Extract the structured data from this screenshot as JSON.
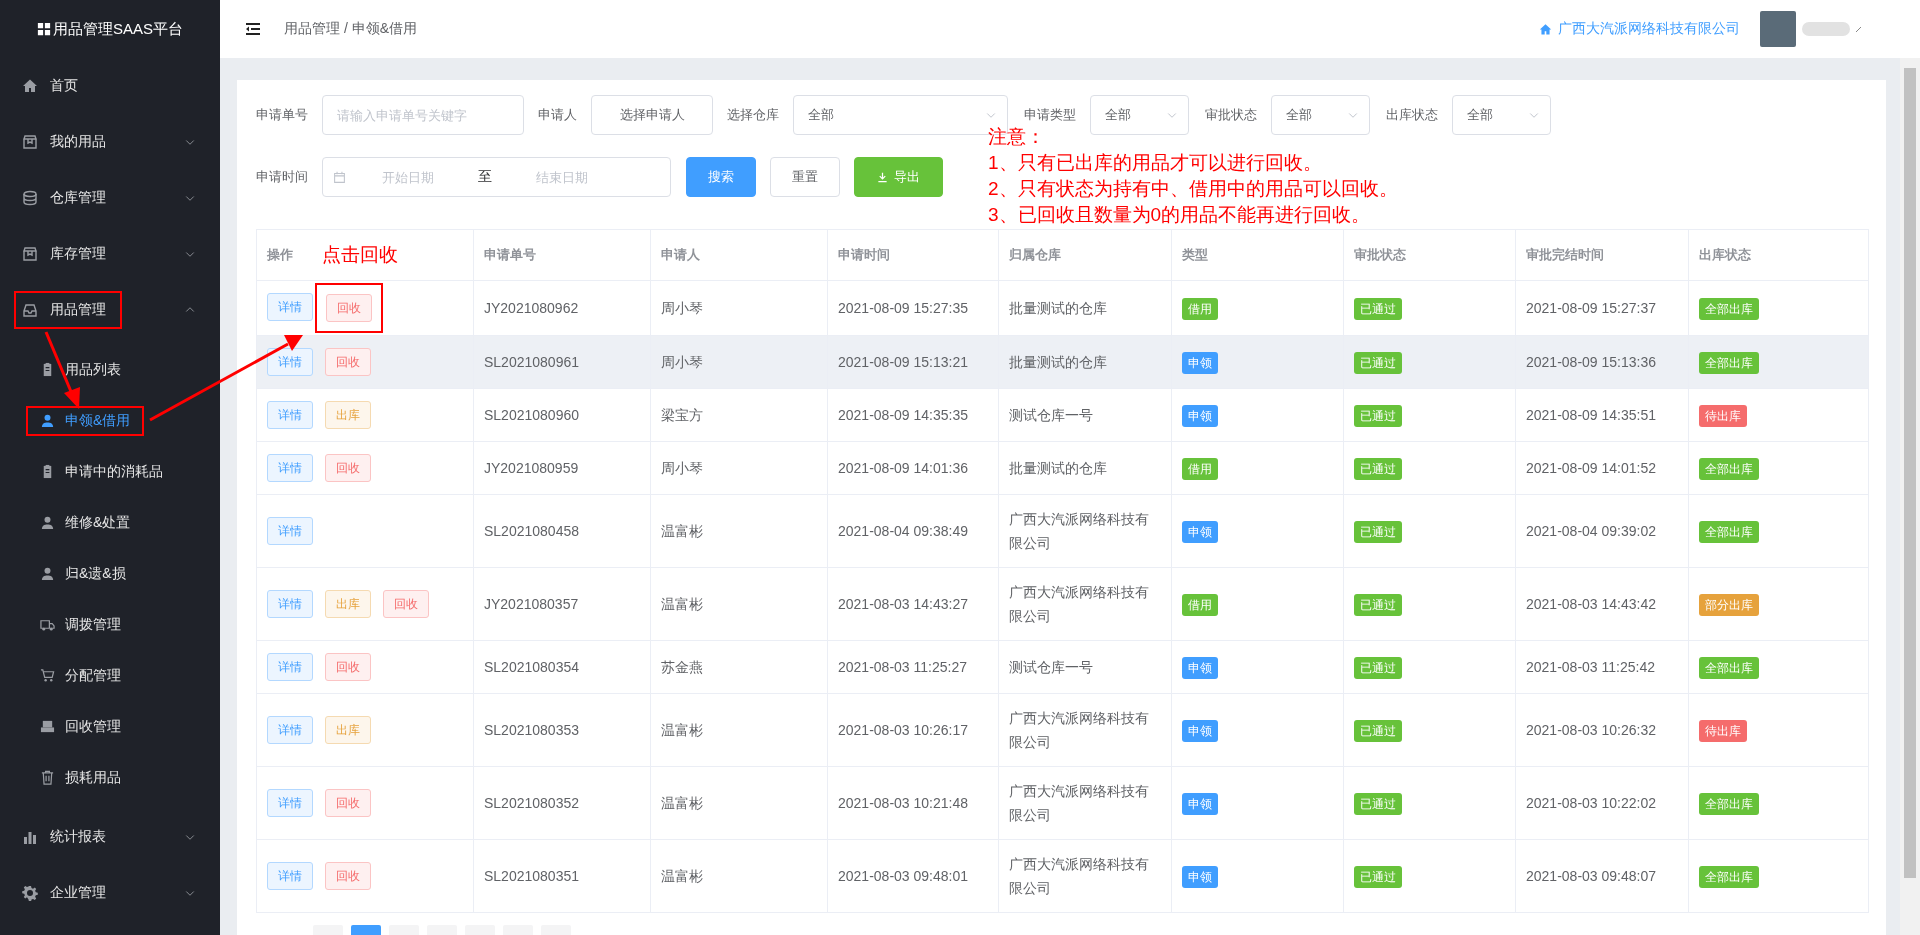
{
  "sidebar": {
    "logo": "用品管理SAAS平台",
    "items": [
      {
        "label": "首页"
      },
      {
        "label": "我的用品",
        "expanded": false
      },
      {
        "label": "仓库管理",
        "expanded": false
      },
      {
        "label": "库存管理",
        "expanded": false
      },
      {
        "label": "用品管理",
        "expanded": true,
        "children": [
          {
            "label": "用品列表",
            "selected": false
          },
          {
            "label": "申领&借用",
            "selected": true
          },
          {
            "label": "申请中的消耗品",
            "selected": false
          },
          {
            "label": "维修&处置",
            "selected": false
          },
          {
            "label": "归&遗&损",
            "selected": false
          },
          {
            "label": "调拨管理",
            "selected": false
          },
          {
            "label": "分配管理",
            "selected": false
          },
          {
            "label": "回收管理",
            "selected": false
          },
          {
            "label": "损耗用品",
            "selected": false
          }
        ]
      },
      {
        "label": "统计报表",
        "expanded": false
      },
      {
        "label": "企业管理",
        "expanded": false
      }
    ]
  },
  "header": {
    "breadcrumb": "用品管理 / 申领&借用",
    "company": "广西大汽派网络科技有限公司"
  },
  "filters": {
    "row_1": [
      {
        "kind": "input",
        "label": "申请单号",
        "placeholder": "请输入申请单号关键字"
      },
      {
        "kind": "picker",
        "label": "申请人",
        "value": "选择申请人"
      },
      {
        "kind": "select",
        "label": "选择仓库",
        "value": "全部"
      },
      {
        "kind": "select",
        "label": "申请类型",
        "value": "全部"
      },
      {
        "kind": "select",
        "label": "审批状态",
        "value": "全部"
      },
      {
        "kind": "select",
        "label": "出库状态",
        "value": "全部"
      }
    ],
    "date_range": {
      "label": "申请时间",
      "start_placeholder": "开始日期",
      "separator": "至",
      "end_placeholder": "结束日期"
    },
    "buttons": [
      {
        "kind": "primary",
        "label": "搜索"
      },
      {
        "kind": "default",
        "label": "重置"
      },
      {
        "kind": "export",
        "label": "导出"
      }
    ]
  },
  "table": {
    "columns": [
      "操作",
      "申请单号",
      "申请人",
      "申请时间",
      "归属仓库",
      "类型",
      "审批状态",
      "审批完结时间",
      "出库状态"
    ],
    "rows": [
      {
        "hovered": false,
        "actions": [
          {
            "kind": "detail",
            "label": "详情"
          },
          {
            "kind": "recycle",
            "label": "回收"
          }
        ],
        "number": "JY2021080962",
        "applicant": "周小琴",
        "time": "2021-08-09 15:27:35",
        "warehouse": "批量测试的仓库",
        "type": {
          "text": "借用",
          "color": "#67c23a"
        },
        "approval": {
          "text": "已通过",
          "color": "#67c23a"
        },
        "finished": "2021-08-09 15:27:37",
        "outbound": {
          "text": "全部出库",
          "color": "#67c23a"
        }
      },
      {
        "hovered": true,
        "actions": [
          {
            "kind": "detail",
            "label": "详情"
          },
          {
            "kind": "recycle",
            "label": "回收"
          }
        ],
        "number": "SL2021080961",
        "applicant": "周小琴",
        "time": "2021-08-09 15:13:21",
        "warehouse": "批量测试的仓库",
        "type": {
          "text": "申领",
          "color": "#409eff"
        },
        "approval": {
          "text": "已通过",
          "color": "#67c23a"
        },
        "finished": "2021-08-09 15:13:36",
        "outbound": {
          "text": "全部出库",
          "color": "#67c23a"
        }
      },
      {
        "hovered": false,
        "actions": [
          {
            "kind": "detail",
            "label": "详情"
          },
          {
            "kind": "outbound",
            "label": "出库"
          }
        ],
        "number": "SL2021080960",
        "applicant": "梁宝方",
        "time": "2021-08-09 14:35:35",
        "warehouse": "测试仓库一号",
        "type": {
          "text": "申领",
          "color": "#409eff"
        },
        "approval": {
          "text": "已通过",
          "color": "#67c23a"
        },
        "finished": "2021-08-09 14:35:51",
        "outbound": {
          "text": "待出库",
          "color": "#f56c6c"
        }
      },
      {
        "hovered": false,
        "actions": [
          {
            "kind": "detail",
            "label": "详情"
          },
          {
            "kind": "recycle",
            "label": "回收"
          }
        ],
        "number": "JY2021080959",
        "applicant": "周小琴",
        "time": "2021-08-09 14:01:36",
        "warehouse": "批量测试的仓库",
        "type": {
          "text": "借用",
          "color": "#67c23a"
        },
        "approval": {
          "text": "已通过",
          "color": "#67c23a"
        },
        "finished": "2021-08-09 14:01:52",
        "outbound": {
          "text": "全部出库",
          "color": "#67c23a"
        }
      },
      {
        "hovered": false,
        "actions": [
          {
            "kind": "detail",
            "label": "详情"
          }
        ],
        "number": "SL2021080458",
        "applicant": "温富彬",
        "time": "2021-08-04 09:38:49",
        "warehouse": "广西大汽派网络科技有限公司",
        "type": {
          "text": "申领",
          "color": "#409eff"
        },
        "approval": {
          "text": "已通过",
          "color": "#67c23a"
        },
        "finished": "2021-08-04 09:39:02",
        "outbound": {
          "text": "全部出库",
          "color": "#67c23a"
        }
      },
      {
        "hovered": false,
        "actions": [
          {
            "kind": "detail",
            "label": "详情"
          },
          {
            "kind": "outbound",
            "label": "出库"
          },
          {
            "kind": "recycle",
            "label": "回收"
          }
        ],
        "number": "JY2021080357",
        "applicant": "温富彬",
        "time": "2021-08-03 14:43:27",
        "warehouse": "广西大汽派网络科技有限公司",
        "type": {
          "text": "借用",
          "color": "#67c23a"
        },
        "approval": {
          "text": "已通过",
          "color": "#67c23a"
        },
        "finished": "2021-08-03 14:43:42",
        "outbound": {
          "text": "部分出库",
          "color": "#e6a23c"
        }
      },
      {
        "hovered": false,
        "actions": [
          {
            "kind": "detail",
            "label": "详情"
          },
          {
            "kind": "recycle",
            "label": "回收"
          }
        ],
        "number": "SL2021080354",
        "applicant": "苏金燕",
        "time": "2021-08-03 11:25:27",
        "warehouse": "测试仓库一号",
        "type": {
          "text": "申领",
          "color": "#409eff"
        },
        "approval": {
          "text": "已通过",
          "color": "#67c23a"
        },
        "finished": "2021-08-03 11:25:42",
        "outbound": {
          "text": "全部出库",
          "color": "#67c23a"
        }
      },
      {
        "hovered": false,
        "actions": [
          {
            "kind": "detail",
            "label": "详情"
          },
          {
            "kind": "outbound",
            "label": "出库"
          }
        ],
        "number": "SL2021080353",
        "applicant": "温富彬",
        "time": "2021-08-03 10:26:17",
        "warehouse": "广西大汽派网络科技有限公司",
        "type": {
          "text": "申领",
          "color": "#409eff"
        },
        "approval": {
          "text": "已通过",
          "color": "#67c23a"
        },
        "finished": "2021-08-03 10:26:32",
        "outbound": {
          "text": "待出库",
          "color": "#f56c6c"
        }
      },
      {
        "hovered": false,
        "actions": [
          {
            "kind": "detail",
            "label": "详情"
          },
          {
            "kind": "recycle",
            "label": "回收"
          }
        ],
        "number": "SL2021080352",
        "applicant": "温富彬",
        "time": "2021-08-03 10:21:48",
        "warehouse": "广西大汽派网络科技有限公司",
        "type": {
          "text": "申领",
          "color": "#409eff"
        },
        "approval": {
          "text": "已通过",
          "color": "#67c23a"
        },
        "finished": "2021-08-03 10:22:02",
        "outbound": {
          "text": "全部出库",
          "color": "#67c23a"
        }
      },
      {
        "hovered": false,
        "actions": [
          {
            "kind": "detail",
            "label": "详情"
          },
          {
            "kind": "recycle",
            "label": "回收"
          }
        ],
        "number": "SL2021080351",
        "applicant": "温富彬",
        "time": "2021-08-03 09:48:01",
        "warehouse": "广西大汽派网络科技有限公司",
        "type": {
          "text": "申领",
          "color": "#409eff"
        },
        "approval": {
          "text": "已通过",
          "color": "#67c23a"
        },
        "finished": "2021-08-03 09:48:07",
        "outbound": {
          "text": "全部出库",
          "color": "#67c23a"
        }
      }
    ]
  },
  "pagination": [
    {
      "selected": false
    },
    {
      "selected": true
    },
    {
      "selected": false
    },
    {
      "selected": false
    },
    {
      "selected": false
    },
    {
      "selected": false
    },
    {
      "selected": false
    }
  ],
  "annotations": {
    "callout": "点击回收",
    "note": [
      "注意：",
      "1、只有已出库的用品才可以进行回收。",
      "2、只有状态为持有中、借用中的用品可以回收。",
      "3、已回收且数量为0的用品不能再进行回收。"
    ]
  }
}
